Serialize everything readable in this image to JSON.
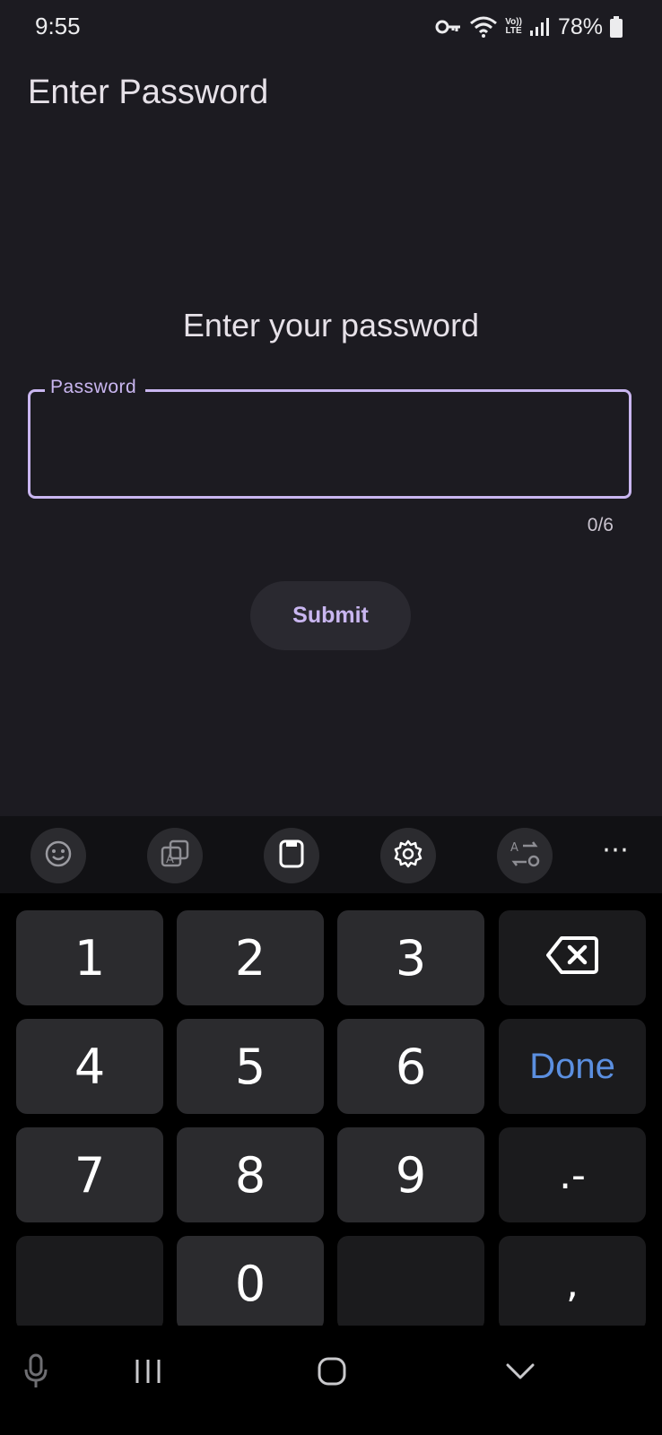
{
  "status_bar": {
    "time": "9:55",
    "volte_top": "Vo))",
    "volte_bottom": "LTE",
    "battery": "78%"
  },
  "app": {
    "title": "Enter Password",
    "prompt": "Enter your password",
    "password_field": {
      "label": "Password",
      "value": "",
      "counter": "0/6"
    },
    "submit_label": "Submit",
    "accent_color": "#c9b6f0"
  },
  "keyboard": {
    "toolbar": [
      "emoji-icon",
      "text-translate-icon",
      "clipboard-icon",
      "settings-icon",
      "mode-switch-icon"
    ],
    "more_label": "⋯",
    "keys": {
      "k1": "1",
      "k2": "2",
      "k3": "3",
      "k4": "4",
      "k5": "5",
      "k6": "6",
      "k7": "7",
      "k8": "8",
      "k9": "9",
      "k0": "0",
      "done": "Done",
      "dot_dash": ".-",
      "comma": ","
    },
    "done_color": "#5b8fe0"
  },
  "nav_bar": [
    "mic-icon",
    "recents-icon",
    "home-icon",
    "hide-keyboard-icon"
  ]
}
